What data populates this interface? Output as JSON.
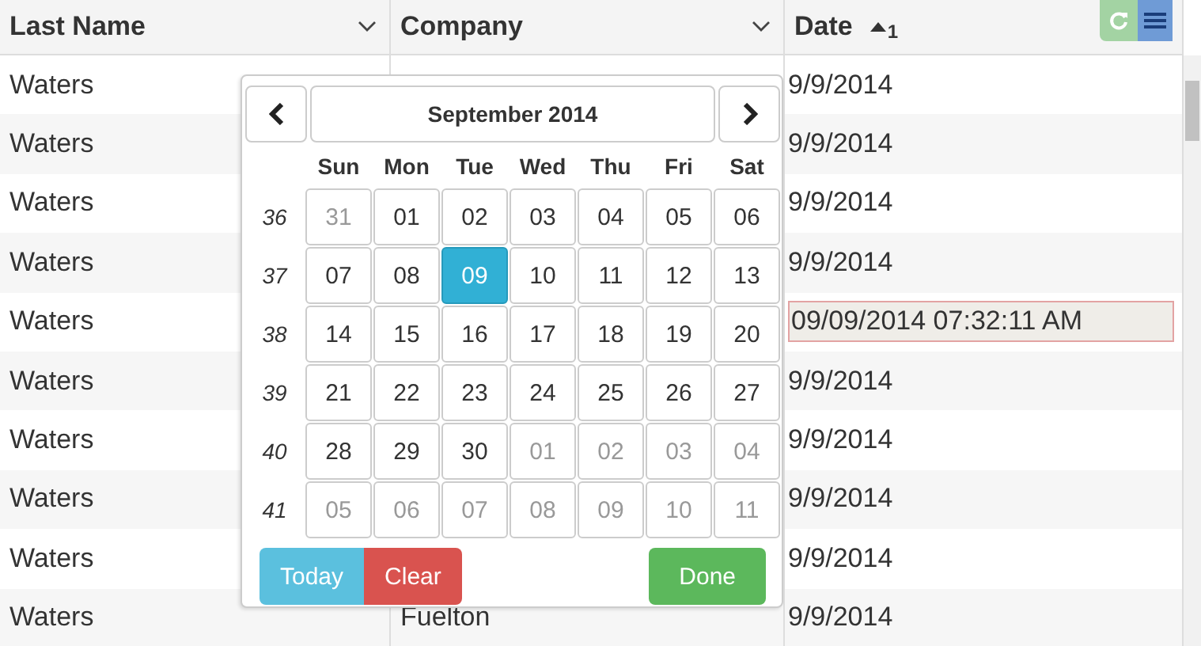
{
  "columns": [
    {
      "label": "Last Name",
      "sorted": false,
      "filter": true
    },
    {
      "label": "Company",
      "sorted": false,
      "filter": true
    },
    {
      "label": "Date",
      "sorted": true,
      "sort_index": "1",
      "filter": false
    }
  ],
  "rows": [
    {
      "last_name": "Waters",
      "date": "9/9/2014",
      "editing": false
    },
    {
      "last_name": "Waters",
      "date": "9/9/2014",
      "editing": false
    },
    {
      "last_name": "Waters",
      "date": "9/9/2014",
      "editing": false
    },
    {
      "last_name": "Waters",
      "date": "9/9/2014",
      "editing": false
    },
    {
      "last_name": "Waters",
      "date": "09/09/2014 07:32:11 AM",
      "editing": true
    },
    {
      "last_name": "Waters",
      "date": "9/9/2014",
      "editing": false
    },
    {
      "last_name": "Waters",
      "date": "9/9/2014",
      "editing": false
    },
    {
      "last_name": "Waters",
      "date": "9/9/2014",
      "editing": false
    },
    {
      "last_name": "Waters",
      "date": "9/9/2014",
      "editing": false
    },
    {
      "last_name": "Waters",
      "company": "Fuelton",
      "date": "9/9/2014",
      "editing": false
    }
  ],
  "datepicker": {
    "title": "September 2014",
    "weekdays": [
      "Sun",
      "Mon",
      "Tue",
      "Wed",
      "Thu",
      "Fri",
      "Sat"
    ],
    "weeks": [
      {
        "number": "36",
        "days": [
          {
            "label": "31",
            "other_month": true,
            "selected": false
          },
          {
            "label": "01",
            "other_month": false,
            "selected": false
          },
          {
            "label": "02",
            "other_month": false,
            "selected": false
          },
          {
            "label": "03",
            "other_month": false,
            "selected": false
          },
          {
            "label": "04",
            "other_month": false,
            "selected": false
          },
          {
            "label": "05",
            "other_month": false,
            "selected": false
          },
          {
            "label": "06",
            "other_month": false,
            "selected": false
          }
        ]
      },
      {
        "number": "37",
        "days": [
          {
            "label": "07",
            "other_month": false,
            "selected": false
          },
          {
            "label": "08",
            "other_month": false,
            "selected": false
          },
          {
            "label": "09",
            "other_month": false,
            "selected": true
          },
          {
            "label": "10",
            "other_month": false,
            "selected": false
          },
          {
            "label": "11",
            "other_month": false,
            "selected": false
          },
          {
            "label": "12",
            "other_month": false,
            "selected": false
          },
          {
            "label": "13",
            "other_month": false,
            "selected": false
          }
        ]
      },
      {
        "number": "38",
        "days": [
          {
            "label": "14",
            "other_month": false,
            "selected": false
          },
          {
            "label": "15",
            "other_month": false,
            "selected": false
          },
          {
            "label": "16",
            "other_month": false,
            "selected": false
          },
          {
            "label": "17",
            "other_month": false,
            "selected": false
          },
          {
            "label": "18",
            "other_month": false,
            "selected": false
          },
          {
            "label": "19",
            "other_month": false,
            "selected": false
          },
          {
            "label": "20",
            "other_month": false,
            "selected": false
          }
        ]
      },
      {
        "number": "39",
        "days": [
          {
            "label": "21",
            "other_month": false,
            "selected": false
          },
          {
            "label": "22",
            "other_month": false,
            "selected": false
          },
          {
            "label": "23",
            "other_month": false,
            "selected": false
          },
          {
            "label": "24",
            "other_month": false,
            "selected": false
          },
          {
            "label": "25",
            "other_month": false,
            "selected": false
          },
          {
            "label": "26",
            "other_month": false,
            "selected": false
          },
          {
            "label": "27",
            "other_month": false,
            "selected": false
          }
        ]
      },
      {
        "number": "40",
        "days": [
          {
            "label": "28",
            "other_month": false,
            "selected": false
          },
          {
            "label": "29",
            "other_month": false,
            "selected": false
          },
          {
            "label": "30",
            "other_month": false,
            "selected": false
          },
          {
            "label": "01",
            "other_month": true,
            "selected": false
          },
          {
            "label": "02",
            "other_month": true,
            "selected": false
          },
          {
            "label": "03",
            "other_month": true,
            "selected": false
          },
          {
            "label": "04",
            "other_month": true,
            "selected": false
          }
        ]
      },
      {
        "number": "41",
        "days": [
          {
            "label": "05",
            "other_month": true,
            "selected": false
          },
          {
            "label": "06",
            "other_month": true,
            "selected": false
          },
          {
            "label": "07",
            "other_month": true,
            "selected": false
          },
          {
            "label": "08",
            "other_month": true,
            "selected": false
          },
          {
            "label": "09",
            "other_month": true,
            "selected": false
          },
          {
            "label": "10",
            "other_month": true,
            "selected": false
          },
          {
            "label": "11",
            "other_month": true,
            "selected": false
          }
        ]
      }
    ],
    "buttons": [
      {
        "label": "Today",
        "kind": "info"
      },
      {
        "label": "Clear",
        "kind": "danger"
      },
      {
        "label": "Done",
        "kind": "success"
      }
    ]
  }
}
